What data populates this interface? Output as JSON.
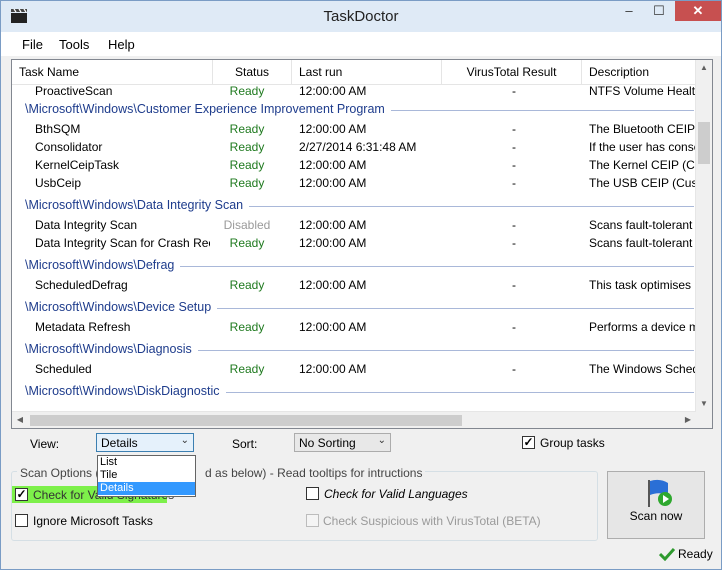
{
  "window": {
    "title": "TaskDoctor",
    "min": "‒",
    "max": "☐",
    "close": "✕"
  },
  "menu": [
    "File",
    "Tools",
    "Help"
  ],
  "columns": [
    "Task Name",
    "Status",
    "Last run",
    "VirusTotal Result",
    "Description"
  ],
  "groups": [
    {
      "label": "",
      "rows": [
        {
          "name": "ProactiveScan",
          "status": "Ready",
          "status_type": "ready",
          "last_run": "12:00:00 AM",
          "vt": "-",
          "desc": "NTFS Volume Health S"
        }
      ]
    },
    {
      "label": "\\Microsoft\\Windows\\Customer Experience Improvement Program",
      "rows": [
        {
          "name": "BthSQM",
          "status": "Ready",
          "status_type": "ready",
          "last_run": "12:00:00 AM",
          "vt": "-",
          "desc": "The Bluetooth CEIP (C"
        },
        {
          "name": "Consolidator",
          "status": "Ready",
          "status_type": "ready",
          "last_run": "2/27/2014 6:31:48 AM",
          "vt": "-",
          "desc": "If the user has conser"
        },
        {
          "name": "KernelCeipTask",
          "status": "Ready",
          "status_type": "ready",
          "last_run": "12:00:00 AM",
          "vt": "-",
          "desc": "The Kernel CEIP (Cust"
        },
        {
          "name": "UsbCeip",
          "status": "Ready",
          "status_type": "ready",
          "last_run": "12:00:00 AM",
          "vt": "-",
          "desc": "The USB CEIP (Custon"
        }
      ]
    },
    {
      "label": "\\Microsoft\\Windows\\Data Integrity Scan",
      "rows": [
        {
          "name": "Data Integrity Scan",
          "status": "Disabled",
          "status_type": "disabled",
          "last_run": "12:00:00 AM",
          "vt": "-",
          "desc": "Scans fault-tolerant vo"
        },
        {
          "name": "Data Integrity Scan for Crash Reco...",
          "status": "Ready",
          "status_type": "ready",
          "last_run": "12:00:00 AM",
          "vt": "-",
          "desc": "Scans fault-tolerant vo"
        }
      ]
    },
    {
      "label": "\\Microsoft\\Windows\\Defrag",
      "rows": [
        {
          "name": "ScheduledDefrag",
          "status": "Ready",
          "status_type": "ready",
          "last_run": "12:00:00 AM",
          "vt": "-",
          "desc": "This task optimises loc"
        }
      ]
    },
    {
      "label": "\\Microsoft\\Windows\\Device Setup",
      "rows": [
        {
          "name": "Metadata Refresh",
          "status": "Ready",
          "status_type": "ready",
          "last_run": "12:00:00 AM",
          "vt": "-",
          "desc": "Performs a device met"
        }
      ]
    },
    {
      "label": "\\Microsoft\\Windows\\Diagnosis",
      "rows": [
        {
          "name": "Scheduled",
          "status": "Ready",
          "status_type": "ready",
          "last_run": "12:00:00 AM",
          "vt": "-",
          "desc": "The Windows Schedu"
        }
      ]
    },
    {
      "label": "\\Microsoft\\Windows\\DiskDiagnostic",
      "rows": []
    }
  ],
  "controls": {
    "view_label": "View:",
    "view_value": "Details",
    "view_options": [
      "List",
      "Tile",
      "Details"
    ],
    "sort_label": "Sort:",
    "sort_value": "No Sorting",
    "group_tasks_label": "Group tasks",
    "group_tasks_checked": true,
    "scan_options_label": "Scan Options (re",
    "scan_options_tail": "d as below) - Read tooltips for intructions",
    "check_valid_signatures": "Check for Valid Signatures",
    "ignore_ms_tasks": "Ignore Microsoft Tasks",
    "check_valid_languages": "Check for Valid Languages",
    "check_suspicious": "Check Suspicious with VirusTotal (BETA)",
    "scan_now": "Scan now"
  },
  "status": {
    "text": "Ready"
  },
  "colors": {
    "ready": "#1f7a1f",
    "group": "#1e3c8c",
    "highlight": "#7df04a",
    "selection": "#3399ff"
  }
}
